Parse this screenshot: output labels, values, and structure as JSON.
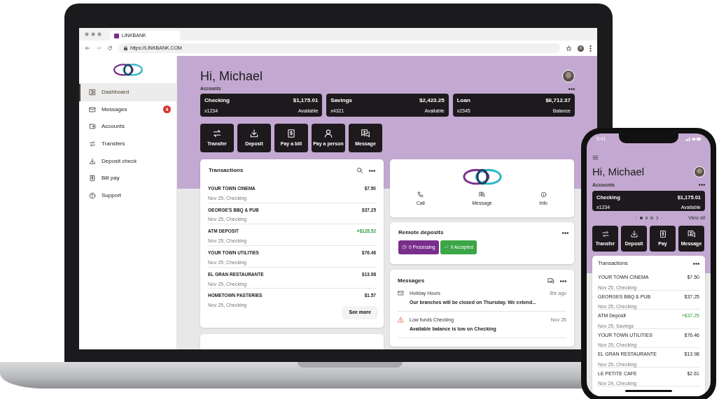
{
  "browser": {
    "tab_title": "LINKBANK",
    "url": "https://LINKBANK.COM"
  },
  "sidebar": {
    "items": [
      {
        "label": "Dashboard",
        "selected": true
      },
      {
        "label": "Messages",
        "selected": false,
        "badge": "4"
      },
      {
        "label": "Accounts",
        "selected": false
      },
      {
        "label": "Transfers",
        "selected": false
      },
      {
        "label": "Deposit check",
        "selected": false
      },
      {
        "label": "Bill pay",
        "selected": false
      },
      {
        "label": "Support",
        "selected": false
      }
    ]
  },
  "greeting": "Hi, Michael",
  "accounts_label": "Accounts",
  "accounts": [
    {
      "name": "Checking",
      "number": "x1234",
      "amount": "$1,175.01",
      "note": "Available"
    },
    {
      "name": "Savings",
      "number": "x4321",
      "amount": "$2,423.25",
      "note": "Available"
    },
    {
      "name": "Loan",
      "number": "x2345",
      "amount": "$6,712.37",
      "note": "Balance"
    }
  ],
  "actions": [
    "Transfer",
    "Deposit",
    "Pay a bill",
    "Pay a person",
    "Message"
  ],
  "transactions": {
    "title": "Transactions",
    "see_more": "See more",
    "rows": [
      {
        "name": "YOUR TOWN CINEMA",
        "detail": "Nov 25, Checking",
        "amount": "$7.50",
        "credit": false
      },
      {
        "name": "GEORGE'S BBQ & PUB",
        "detail": "Nov 25, Checking",
        "amount": "$37.25",
        "credit": false
      },
      {
        "name": "ATM DEPOSIT",
        "detail": "Nov 25, Checking",
        "amount": "+$128.52",
        "credit": true
      },
      {
        "name": "YOUR TOWN UTILITIES",
        "detail": "Nov 25, Checking",
        "amount": "$76.46",
        "credit": false
      },
      {
        "name": "EL GRAN RESTAURANTE",
        "detail": "Nov 25, Checking",
        "amount": "$13.98",
        "credit": false
      },
      {
        "name": "HOMETOWN PASTERIES",
        "detail": "Nov 25, Checking",
        "amount": "$1.57",
        "credit": false
      }
    ]
  },
  "contact": {
    "actions": [
      "Call",
      "Message",
      "Info"
    ]
  },
  "remote_deposits": {
    "title": "Remote deposits",
    "statuses": [
      {
        "label": "0 Processing",
        "color": "#7a2e8c"
      },
      {
        "label": "9 Accepted",
        "color": "#3aa646"
      }
    ]
  },
  "messages": {
    "title": "Messages",
    "items": [
      {
        "kind": "mail",
        "title": "Holiday Hours",
        "body": "Our branches will be closed on Thursday. We extend...",
        "time": "8hr ago"
      },
      {
        "kind": "alert",
        "title": "Low funds Checking",
        "body": "Available balance is low on Checking",
        "time": "Nov 25"
      }
    ]
  },
  "phone": {
    "time": "9:41",
    "greeting": "Hi, Michael",
    "accounts_label": "Accounts",
    "account": {
      "name": "Checking",
      "number": "x1234",
      "amount": "$1,175.01",
      "note": "Available"
    },
    "dots": [
      {
        "selected": true
      },
      {
        "selected": false
      },
      {
        "selected": false
      }
    ],
    "view_all": "View all",
    "actions": [
      "Transfer",
      "Deposit",
      "Pay",
      "Message"
    ],
    "transactions": {
      "title": "Transactions",
      "rows": [
        {
          "name": "YOUR TOWN CINEMA",
          "detail": "Nov 25, Checking",
          "amount": "$7.50",
          "credit": false
        },
        {
          "name": "GEORGES BBQ & PUB",
          "detail": "Nov 25, Checking",
          "amount": "$37.25",
          "credit": false
        },
        {
          "name": "ATM Deposit",
          "detail": "Nov 25, Savings",
          "amount": "+$37.25",
          "credit": true
        },
        {
          "name": "YOUR TOWN UTILITIES",
          "detail": "Nov 25, Checking",
          "amount": "$76.46",
          "credit": false
        },
        {
          "name": "EL GRAN RESTAURANTE",
          "detail": "Nov 25, Checking",
          "amount": "$13.98",
          "credit": false
        },
        {
          "name": "LE PETITE CAFE",
          "detail": "Nov 24, Checking",
          "amount": "$2.61",
          "credit": false
        }
      ]
    }
  }
}
